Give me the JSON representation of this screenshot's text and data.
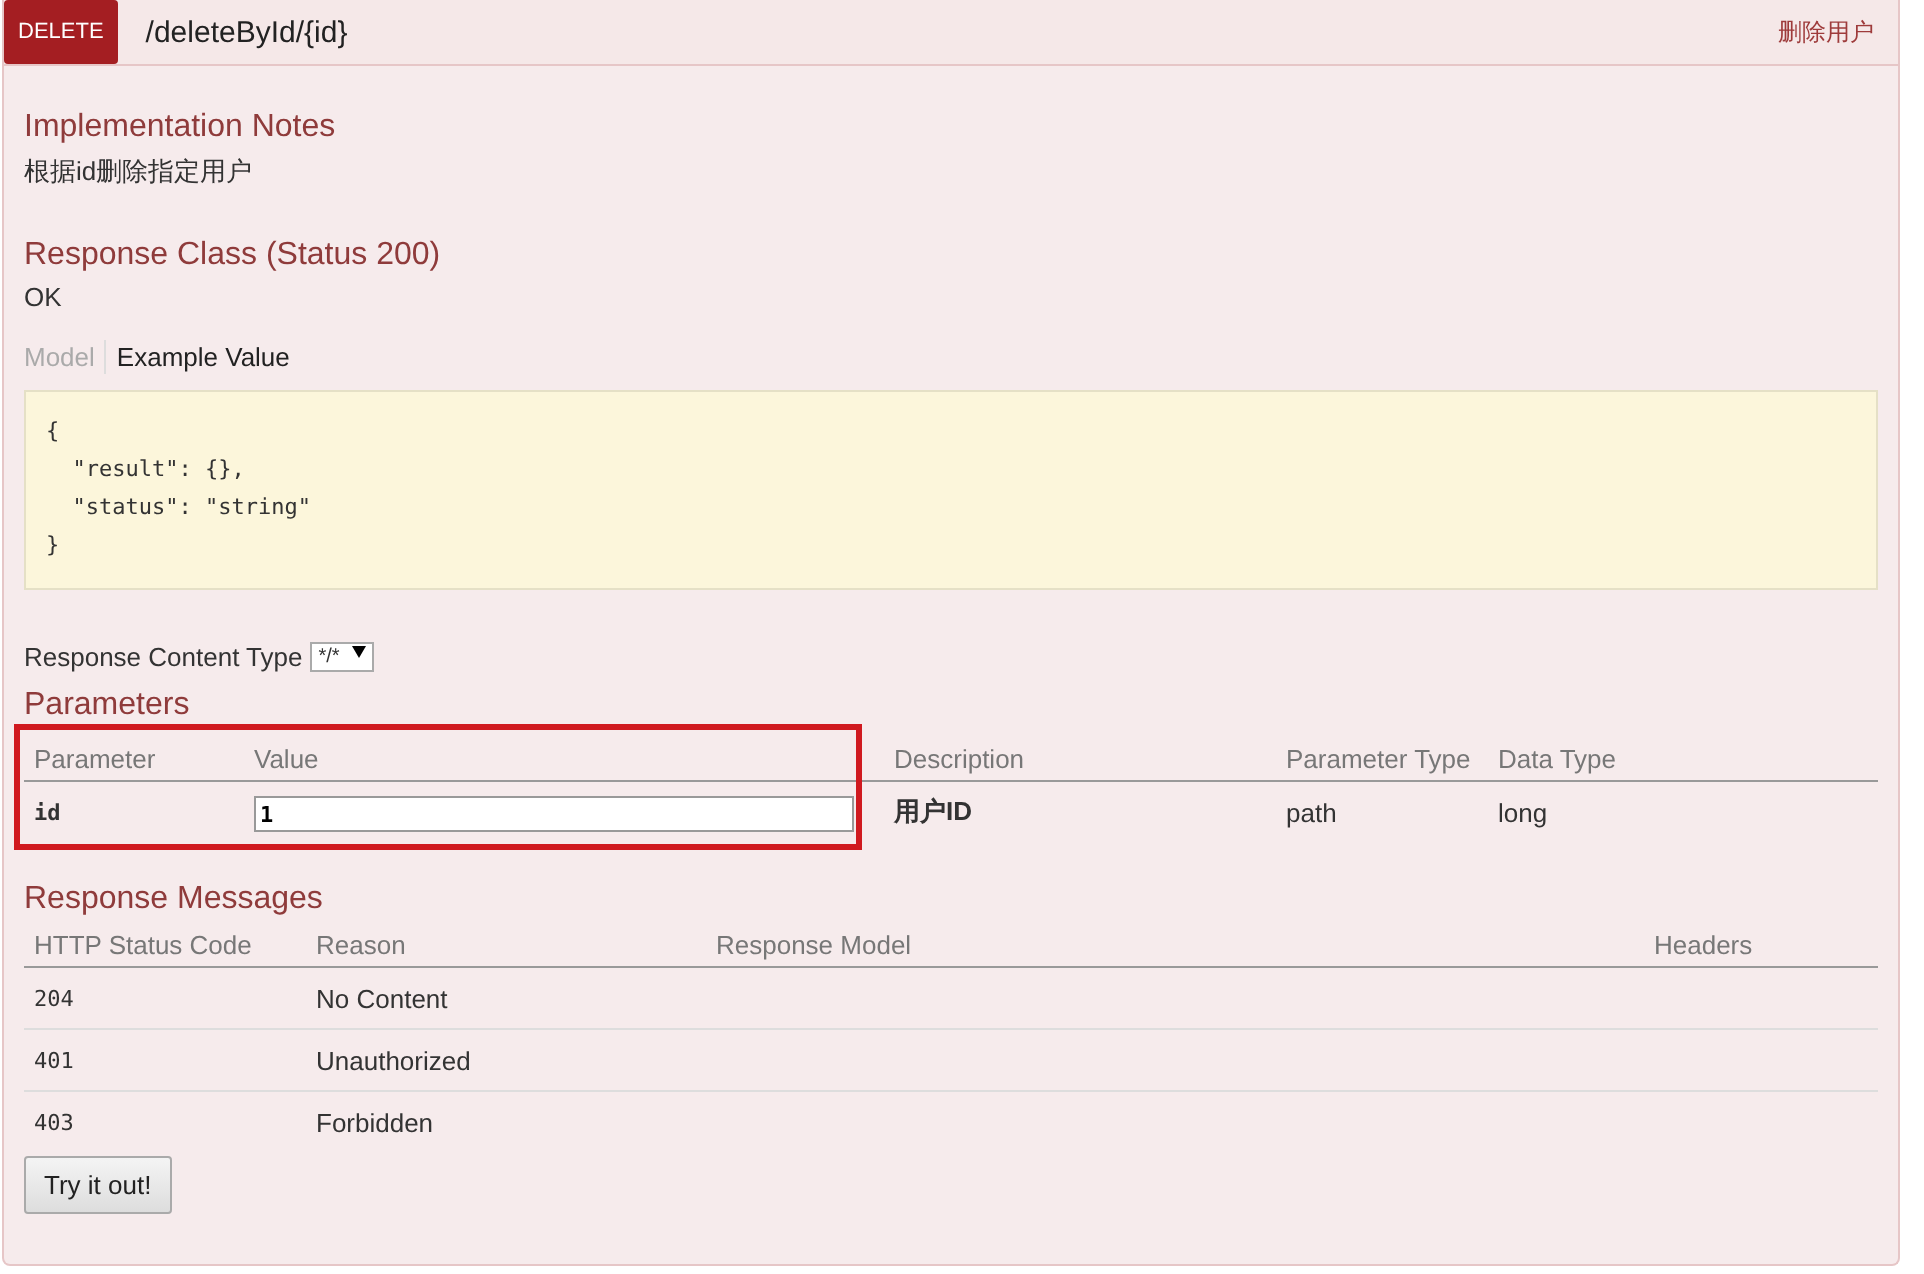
{
  "operation": {
    "method": "DELETE",
    "path": "/deleteById/{id}",
    "summary": "删除用户"
  },
  "implementation_notes": {
    "title": "Implementation Notes",
    "text": "根据id删除指定用户"
  },
  "response_class": {
    "title": "Response Class (Status 200)",
    "text": "OK"
  },
  "model_tabs": [
    {
      "label": "Model",
      "selected": false
    },
    {
      "label": "Example Value",
      "selected": true
    }
  ],
  "example_value": "{\n  \"result\": {},\n  \"status\": \"string\"\n}",
  "response_content_type": {
    "label": "Response Content Type",
    "value": "*/*"
  },
  "parameters": {
    "title": "Parameters",
    "columns": [
      "Parameter",
      "Value",
      "Description",
      "Parameter Type",
      "Data Type"
    ],
    "rows": [
      {
        "name": "id",
        "value": "1",
        "description": "用户ID",
        "parameter_type": "path",
        "data_type": "long"
      }
    ]
  },
  "response_messages": {
    "title": "Response Messages",
    "columns": [
      "HTTP Status Code",
      "Reason",
      "Response Model",
      "Headers"
    ],
    "rows": [
      {
        "code": "204",
        "reason": "No Content"
      },
      {
        "code": "401",
        "reason": "Unauthorized"
      },
      {
        "code": "403",
        "reason": "Forbidden"
      }
    ]
  },
  "try_button": "Try it out!"
}
